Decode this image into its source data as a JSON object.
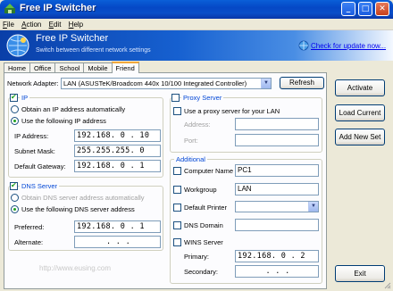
{
  "window": {
    "title": "Free IP Switcher",
    "minimize": "_",
    "maximize": "□",
    "close": "✕"
  },
  "menu": [
    {
      "key": "F",
      "rest": "ile"
    },
    {
      "key": "A",
      "rest": "ction"
    },
    {
      "key": "E",
      "rest": "dit"
    },
    {
      "key": "H",
      "rest": "elp"
    }
  ],
  "banner": {
    "title": "Free IP Switcher",
    "subtitle": "Switch between different network settings",
    "link": "Check for update now..."
  },
  "tabs": [
    "Home",
    "Office",
    "School",
    "Mobile",
    "Friend"
  ],
  "adapter": {
    "label": "Network Adapter:",
    "value": "LAN (ASUSTeK/Broadcom 440x 10/100 Integrated Controller)",
    "refresh": "Refresh"
  },
  "ip": {
    "title": "IP",
    "auto": "Obtain an IP address automatically",
    "manual": "Use the following IP address",
    "address_label": "IP Address:",
    "address": "192.168. 0 . 10",
    "mask_label": "Subnet Mask:",
    "mask": "255.255.255. 0",
    "gateway_label": "Default Gateway:",
    "gateway": "192.168. 0 . 1"
  },
  "dns": {
    "title": "DNS Server",
    "auto": "Obtain DNS server address automatically",
    "manual": "Use the following DNS server address",
    "preferred_label": "Preferred:",
    "preferred": "192.168. 0 . 1",
    "alternate_label": "Alternate:",
    "alternate": ".    .    ."
  },
  "proxy": {
    "title": "Proxy Server",
    "use": "Use a proxy server for your LAN",
    "address_label": "Address:",
    "port_label": "Port:"
  },
  "additional": {
    "title": "Additional",
    "computer_name_label": "Computer Name",
    "computer_name": "PC1",
    "workgroup_label": "Workgroup",
    "workgroup": "LAN",
    "printer_label": "Default Printer",
    "dns_domain_label": "DNS Domain",
    "wins_label": "WINS Server",
    "primary_label": "Primary:",
    "primary": "192.168. 0 . 2",
    "secondary_label": "Secondary:",
    "secondary": ".    .    ."
  },
  "actions": {
    "activate": "Activate",
    "load": "Load Current",
    "add": "Add New Set",
    "exit": "Exit"
  },
  "watermark": "http://www.eusing.com"
}
